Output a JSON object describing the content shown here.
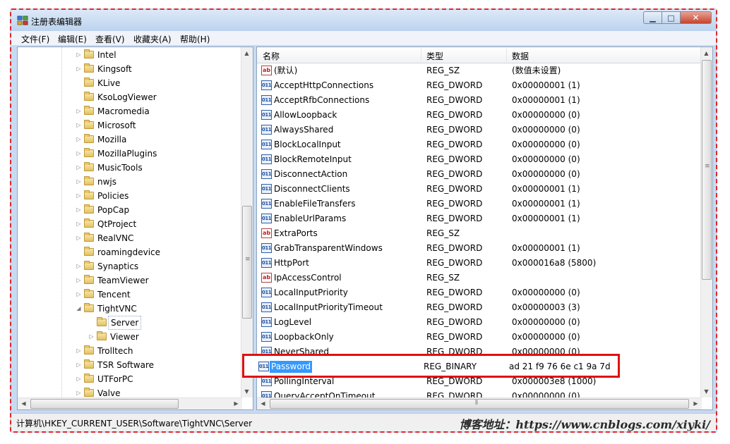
{
  "window": {
    "title": "注册表编辑器",
    "close_glyph": "✕",
    "min_glyph": "▁",
    "max_glyph": "□"
  },
  "menu": [
    "文件(F)",
    "编辑(E)",
    "查看(V)",
    "收藏夹(A)",
    "帮助(H)"
  ],
  "tree": {
    "items": [
      {
        "label": "Intel",
        "depth": 0,
        "expander": "▷"
      },
      {
        "label": "Kingsoft",
        "depth": 0,
        "expander": "▷"
      },
      {
        "label": "KLive",
        "depth": 0,
        "expander": ""
      },
      {
        "label": "KsoLogViewer",
        "depth": 0,
        "expander": ""
      },
      {
        "label": "Macromedia",
        "depth": 0,
        "expander": "▷"
      },
      {
        "label": "Microsoft",
        "depth": 0,
        "expander": "▷"
      },
      {
        "label": "Mozilla",
        "depth": 0,
        "expander": "▷"
      },
      {
        "label": "MozillaPlugins",
        "depth": 0,
        "expander": "▷"
      },
      {
        "label": "MusicTools",
        "depth": 0,
        "expander": "▷"
      },
      {
        "label": "nwjs",
        "depth": 0,
        "expander": "▷"
      },
      {
        "label": "Policies",
        "depth": 0,
        "expander": "▷"
      },
      {
        "label": "PopCap",
        "depth": 0,
        "expander": "▷"
      },
      {
        "label": "QtProject",
        "depth": 0,
        "expander": "▷"
      },
      {
        "label": "RealVNC",
        "depth": 0,
        "expander": "▷"
      },
      {
        "label": "roamingdevice",
        "depth": 0,
        "expander": ""
      },
      {
        "label": "Synaptics",
        "depth": 0,
        "expander": "▷"
      },
      {
        "label": "TeamViewer",
        "depth": 0,
        "expander": "▷"
      },
      {
        "label": "Tencent",
        "depth": 0,
        "expander": "▷"
      },
      {
        "label": "TightVNC",
        "depth": 0,
        "expander": "◢"
      },
      {
        "label": "Server",
        "depth": 1,
        "expander": "",
        "selected": true
      },
      {
        "label": "Viewer",
        "depth": 1,
        "expander": "▷"
      },
      {
        "label": "Trolltech",
        "depth": 0,
        "expander": "▷"
      },
      {
        "label": "TSR Software",
        "depth": 0,
        "expander": "▷"
      },
      {
        "label": "UTForPC",
        "depth": 0,
        "expander": "▷"
      },
      {
        "label": "Valve",
        "depth": 0,
        "expander": "▷"
      }
    ]
  },
  "list": {
    "columns": {
      "name": "名称",
      "type": "类型",
      "data": "数据"
    },
    "rows": [
      {
        "name": "(默认)",
        "type": "REG_SZ",
        "data": "(数值未设置)",
        "icon": "str"
      },
      {
        "name": "AcceptHttpConnections",
        "type": "REG_DWORD",
        "data": "0x00000001 (1)",
        "icon": "bin"
      },
      {
        "name": "AcceptRfbConnections",
        "type": "REG_DWORD",
        "data": "0x00000001 (1)",
        "icon": "bin"
      },
      {
        "name": "AllowLoopback",
        "type": "REG_DWORD",
        "data": "0x00000000 (0)",
        "icon": "bin"
      },
      {
        "name": "AlwaysShared",
        "type": "REG_DWORD",
        "data": "0x00000000 (0)",
        "icon": "bin"
      },
      {
        "name": "BlockLocalInput",
        "type": "REG_DWORD",
        "data": "0x00000000 (0)",
        "icon": "bin"
      },
      {
        "name": "BlockRemoteInput",
        "type": "REG_DWORD",
        "data": "0x00000000 (0)",
        "icon": "bin"
      },
      {
        "name": "DisconnectAction",
        "type": "REG_DWORD",
        "data": "0x00000000 (0)",
        "icon": "bin"
      },
      {
        "name": "DisconnectClients",
        "type": "REG_DWORD",
        "data": "0x00000001 (1)",
        "icon": "bin"
      },
      {
        "name": "EnableFileTransfers",
        "type": "REG_DWORD",
        "data": "0x00000001 (1)",
        "icon": "bin"
      },
      {
        "name": "EnableUrlParams",
        "type": "REG_DWORD",
        "data": "0x00000001 (1)",
        "icon": "bin"
      },
      {
        "name": "ExtraPorts",
        "type": "REG_SZ",
        "data": "",
        "icon": "str"
      },
      {
        "name": "GrabTransparentWindows",
        "type": "REG_DWORD",
        "data": "0x00000001 (1)",
        "icon": "bin"
      },
      {
        "name": "HttpPort",
        "type": "REG_DWORD",
        "data": "0x000016a8 (5800)",
        "icon": "bin"
      },
      {
        "name": "IpAccessControl",
        "type": "REG_SZ",
        "data": "",
        "icon": "str"
      },
      {
        "name": "LocalInputPriority",
        "type": "REG_DWORD",
        "data": "0x00000000 (0)",
        "icon": "bin"
      },
      {
        "name": "LocalInputPriorityTimeout",
        "type": "REG_DWORD",
        "data": "0x00000003 (3)",
        "icon": "bin"
      },
      {
        "name": "LogLevel",
        "type": "REG_DWORD",
        "data": "0x00000000 (0)",
        "icon": "bin"
      },
      {
        "name": "LoopbackOnly",
        "type": "REG_DWORD",
        "data": "0x00000000 (0)",
        "icon": "bin"
      },
      {
        "name": "NeverShared",
        "type": "REG_DWORD",
        "data": "0x00000000 (0)",
        "icon": "bin"
      },
      {
        "name": "Password",
        "type": "REG_BINARY",
        "data": "ad 21 f9 76 6e c1 9a 7d",
        "icon": "bin",
        "selected": true
      },
      {
        "name": "PollingInterval",
        "type": "REG_DWORD",
        "data": "0x000003e8 (1000)",
        "icon": "bin"
      },
      {
        "name": "QueryAcceptOnTimeout",
        "type": "REG_DWORD",
        "data": "0x00000000 (0)",
        "icon": "bin"
      }
    ],
    "icon_glyphs": {
      "str": "ab",
      "bin": "011"
    }
  },
  "status": {
    "path": "计算机\\HKEY_CURRENT_USER\\Software\\TightVNC\\Server"
  },
  "watermark": "博客地址：https://www.cnblogs.com/xiyki/",
  "colors": {
    "selection": "#3399ff",
    "highlight_box": "#e01010",
    "dashed_border": "#e0282a"
  }
}
